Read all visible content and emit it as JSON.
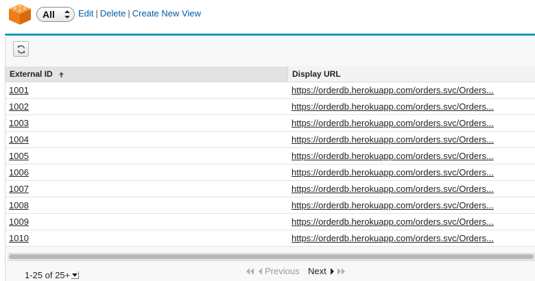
{
  "header": {
    "view_selected": "All",
    "links": {
      "edit": "Edit",
      "separator": "|",
      "delete": "Delete",
      "create_new_view": "Create New View"
    },
    "icon": "orange-cube-icon"
  },
  "toolbar": {
    "refresh_icon": "refresh-icon"
  },
  "table": {
    "columns": [
      {
        "label": "External ID",
        "sorted": "ascending"
      },
      {
        "label": "Display URL"
      }
    ],
    "rows": [
      {
        "external_id": "1001",
        "display_url": "https://orderdb.herokuapp.com/orders.svc/Orders..."
      },
      {
        "external_id": "1002",
        "display_url": "https://orderdb.herokuapp.com/orders.svc/Orders..."
      },
      {
        "external_id": "1003",
        "display_url": "https://orderdb.herokuapp.com/orders.svc/Orders..."
      },
      {
        "external_id": "1004",
        "display_url": "https://orderdb.herokuapp.com/orders.svc/Orders..."
      },
      {
        "external_id": "1005",
        "display_url": "https://orderdb.herokuapp.com/orders.svc/Orders..."
      },
      {
        "external_id": "1006",
        "display_url": "https://orderdb.herokuapp.com/orders.svc/Orders..."
      },
      {
        "external_id": "1007",
        "display_url": "https://orderdb.herokuapp.com/orders.svc/Orders..."
      },
      {
        "external_id": "1008",
        "display_url": "https://orderdb.herokuapp.com/orders.svc/Orders..."
      },
      {
        "external_id": "1009",
        "display_url": "https://orderdb.herokuapp.com/orders.svc/Orders..."
      },
      {
        "external_id": "1010",
        "display_url": "https://orderdb.herokuapp.com/orders.svc/Orders..."
      }
    ]
  },
  "pager": {
    "range": "1-25 of 25+",
    "previous": "Previous",
    "next": "Next"
  },
  "colors": {
    "accent": "#1797c0",
    "link": "#015ba7",
    "icon_orange": "#f2811d"
  }
}
